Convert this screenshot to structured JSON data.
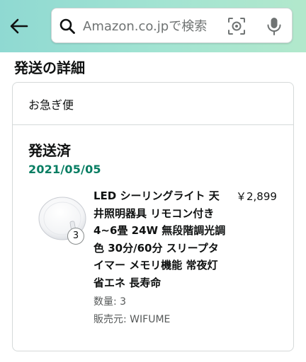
{
  "search": {
    "placeholder": "Amazon.co.jpで検索",
    "back_icon": "arrow-left-icon",
    "search_icon": "magnifier-icon",
    "camera_icon": "camera-lens-icon",
    "mic_icon": "microphone-icon"
  },
  "section": {
    "title": "発送の詳細"
  },
  "shipment": {
    "speed": "お急ぎ便",
    "status": "発送済",
    "date": "2021/05/05"
  },
  "item": {
    "title": "LED シーリングライト 天井照明器具 リモコン付き 4~6畳 24W 無段階調光調色 30分/60分 スリープタイマー メモリ機能 常夜灯 省エネ 長寿命",
    "price": "￥2,899",
    "quantity_badge": "3",
    "quantity": "数量: 3",
    "seller": "販売元: WIFUME"
  },
  "colors": {
    "header_gradient_start": "#8fd9d2",
    "header_gradient_end": "#b2e8cc",
    "date_green": "#067d62",
    "border": "#d5d9d9"
  }
}
